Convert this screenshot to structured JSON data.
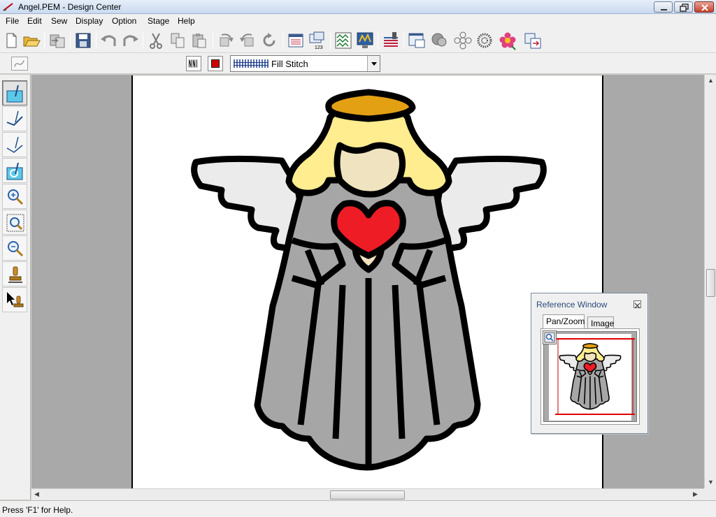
{
  "window": {
    "title": "Angel.PEM - Design Center"
  },
  "menubar": {
    "items": [
      "File",
      "Edit",
      "Sew",
      "Display",
      "Option",
      "Stage",
      "Help"
    ]
  },
  "toolbar": {
    "buttons": [
      "new-icon",
      "open-icon",
      "import-icon",
      "save-icon",
      "undo-icon",
      "redo-icon",
      "cut-icon",
      "copy-icon",
      "paste-icon",
      "rotate-left-icon",
      "rotate-right-icon",
      "refresh-icon",
      "stitch-preview-icon",
      "sewing-order-icon",
      "zigzag-icon",
      "realistic-preview-icon",
      "send-to-card-icon",
      "reference-window-icon",
      "shape-icon",
      "flower-outline-icon",
      "dotted-flower-icon",
      "color-flower-icon",
      "layout-icon"
    ]
  },
  "stitch_toolbar": {
    "combo_value": "Fill Stitch",
    "thread_color": "#cc0000"
  },
  "left_tools": [
    "fill-stitch-tool-icon",
    "line-stitch-tool-icon",
    "outline-stitch-tool-icon",
    "region-tool-icon",
    "zoom-in-icon",
    "zoom-fit-icon",
    "zoom-out-icon",
    "stamp-icon",
    "select-stamp-icon"
  ],
  "reference_window": {
    "title": "Reference Window",
    "tabs": [
      "Pan/Zoom",
      "Image"
    ],
    "active_tab": "Pan/Zoom"
  },
  "statusbar": {
    "text": "Press 'F1' for Help."
  },
  "colors": {
    "wing": "#ebebeb",
    "robe": "#a6a6a6",
    "hair": "#ffed90",
    "face": "#f0e3bf",
    "halo": "#e3a013",
    "heart": "#ee1c24",
    "outline": "#000000"
  }
}
